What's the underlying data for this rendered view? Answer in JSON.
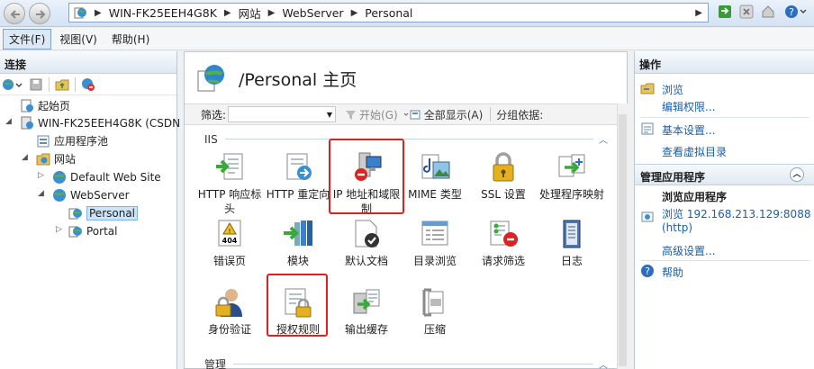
{
  "address": {
    "crumbs": [
      "WIN-FK25EEH4G8K",
      "网站",
      "WebServer",
      "Personal"
    ],
    "arrow": "▶"
  },
  "menu": [
    "文件(F)",
    "视图(V)",
    "帮助(H)"
  ],
  "connections": {
    "title": "连接",
    "tree": {
      "start": "起始页",
      "server": "WIN-FK25EEH4G8K (CSDN",
      "apppools": "应用程序池",
      "sites": "网站",
      "default_site": "Default Web Site",
      "webserver": "WebServer",
      "personal": "Personal",
      "portal": "Portal"
    }
  },
  "center": {
    "title": "/Personal 主页",
    "filter": {
      "label": "筛选:",
      "start": "开始(G)",
      "show_all": "全部显示(A)",
      "group_by": "分组依据:"
    },
    "groups": {
      "iis": "IIS",
      "manage": "管理"
    },
    "features": [
      "HTTP 响应标头",
      "HTTP 重定向",
      "IP 地址和域限制",
      "MIME 类型",
      "SSL 设置",
      "处理程序映射",
      "错误页",
      "模块",
      "默认文档",
      "目录浏览",
      "请求筛选",
      "日志",
      "身份验证",
      "授权规则",
      "输出缓存",
      "压缩"
    ]
  },
  "actions": {
    "title": "操作",
    "browse": "浏览",
    "edit_perms": "编辑权限...",
    "basic": "基本设置...",
    "virtual_dirs": "查看虚拟目录",
    "manage_app": "管理应用程序",
    "browse_app": "浏览应用程序",
    "browse_addr": "浏览 192.168.213.129:8088",
    "browse_proto": "(http)",
    "advanced": "高级设置...",
    "help": "帮助"
  }
}
